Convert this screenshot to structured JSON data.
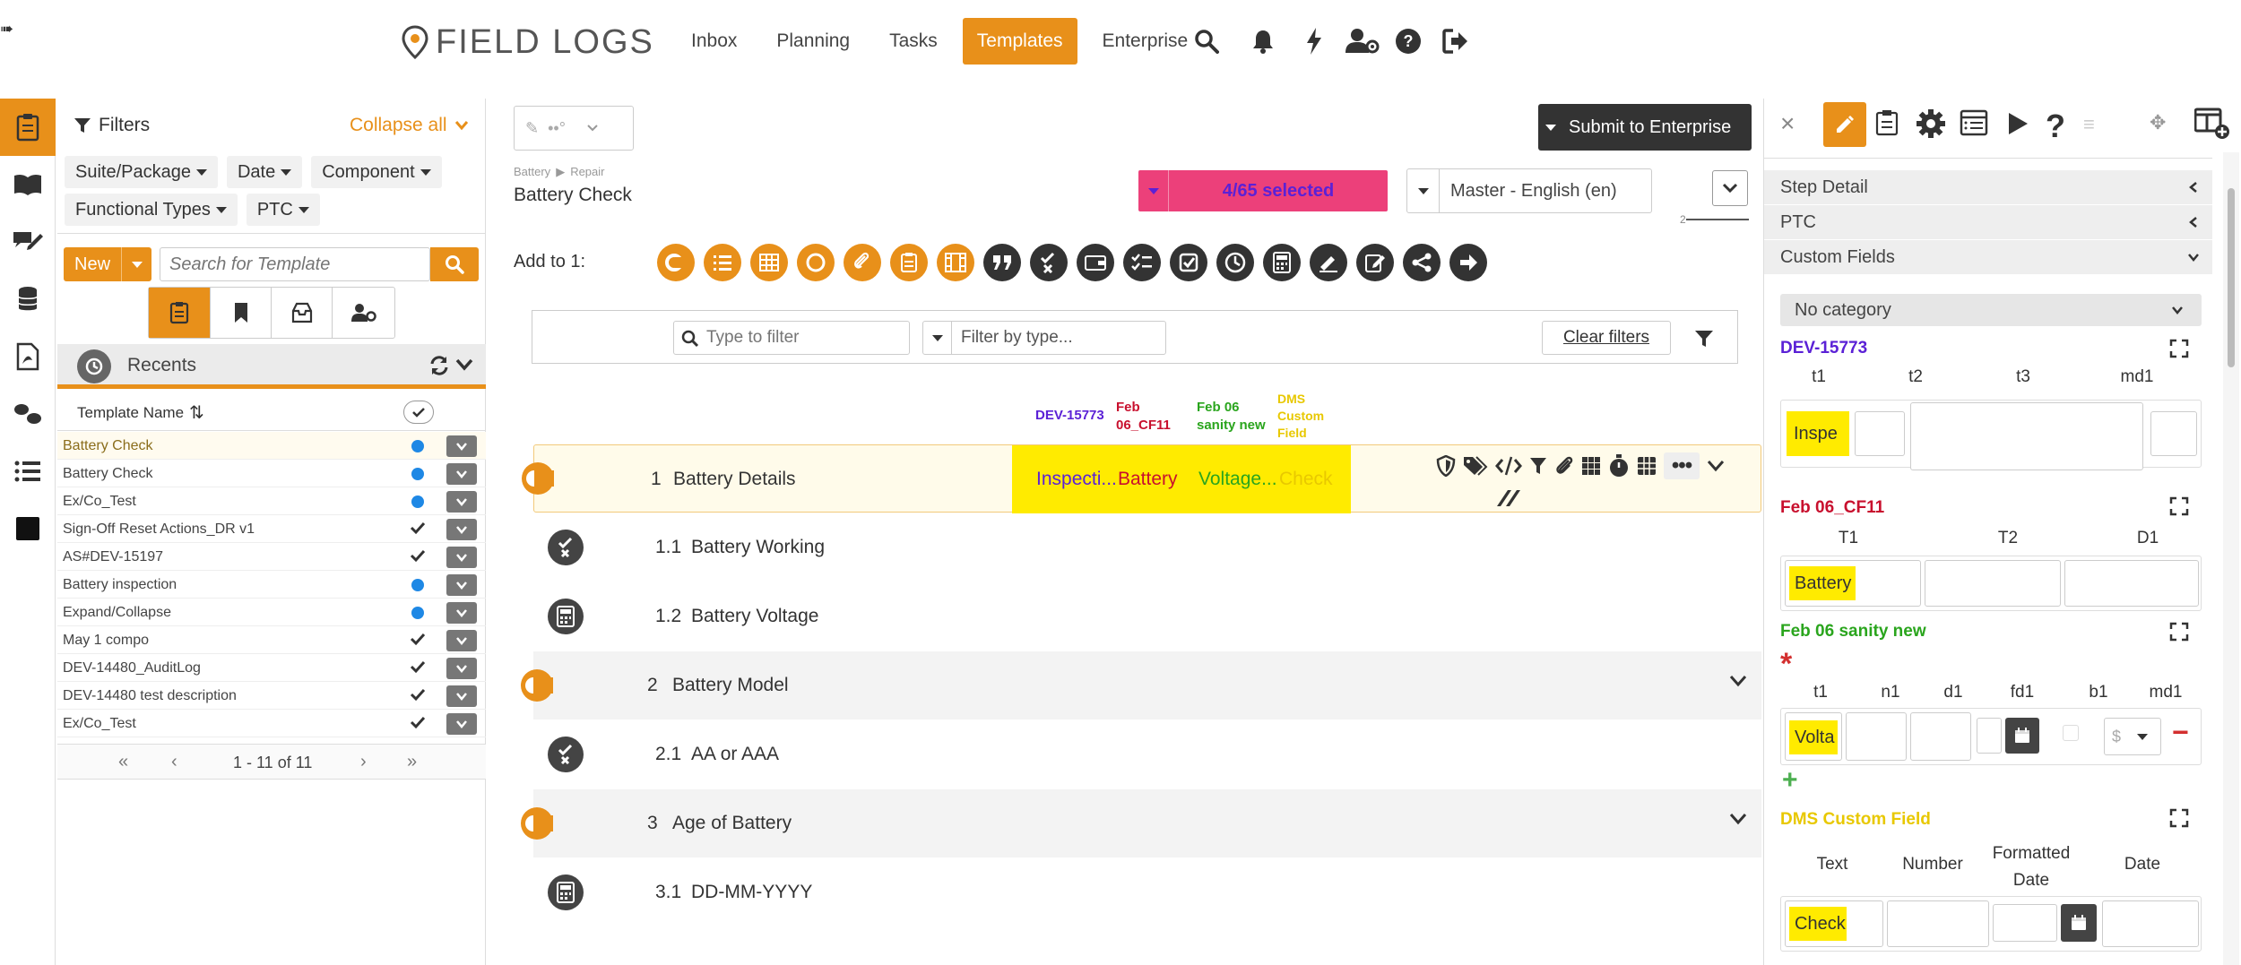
{
  "app": {
    "brand": "FIELD LOGS",
    "nav": [
      "Inbox",
      "Planning",
      "Tasks",
      "Templates",
      "Enterprise"
    ],
    "active_nav": "Templates",
    "accent": "#e8901a"
  },
  "filters": {
    "title": "Filters",
    "collapse_all": "Collapse all",
    "chips": [
      "Suite/Package",
      "Date",
      "Component",
      "Functional Types",
      "PTC"
    ],
    "new_label": "New",
    "search_placeholder": "Search for Template",
    "recents_label": "Recents",
    "column_header": "Template Name",
    "rows": [
      {
        "name": "Battery Check",
        "status": "dot"
      },
      {
        "name": "Battery Check",
        "status": "dot"
      },
      {
        "name": "Ex/Co_Test",
        "status": "dot"
      },
      {
        "name": "Sign-Off Reset Actions_DR v1",
        "status": "check"
      },
      {
        "name": "AS#DEV-15197",
        "status": "check"
      },
      {
        "name": "Battery inspection",
        "status": "dot"
      },
      {
        "name": "Expand/Collapse",
        "status": "dot"
      },
      {
        "name": "May 1 compo",
        "status": "check"
      },
      {
        "name": "DEV-14480_AuditLog",
        "status": "check"
      },
      {
        "name": "DEV-14480 test description",
        "status": "check"
      },
      {
        "name": "Ex/Co_Test",
        "status": "check"
      }
    ],
    "pagination": "1 - 11 of 11"
  },
  "center": {
    "pencil_label": "••°",
    "submit_label": "Submit to Enterprise",
    "breadcrumb": [
      "Battery",
      "Repair"
    ],
    "template_title": "Battery Check",
    "selected_label": "4/65 selected",
    "language": "Master - English (en)",
    "indicator": "2",
    "add_to_label": "Add to 1:",
    "filter_placeholder": "Type to filter",
    "type_placeholder": "Filter by type...",
    "clear_filters": "Clear filters",
    "col_tags": [
      {
        "text": "DEV-15773",
        "color": "#5b21d6"
      },
      {
        "text": "Feb 06_CF11",
        "color": "#c8102e"
      },
      {
        "text": "Feb 06 sanity new",
        "color": "#2aa51d"
      },
      {
        "text": "DMS Custom Field",
        "color": "#e8c800"
      }
    ],
    "step1": {
      "num": "1",
      "label": "Battery Details",
      "values": [
        "Inspecti...",
        "Battery",
        "Voltage...",
        "Check"
      ]
    },
    "steps": [
      {
        "num": "1.1",
        "label": "Battery Working",
        "icon": "close-circle-icon",
        "kind": "sub"
      },
      {
        "num": "1.2",
        "label": "Battery Voltage",
        "icon": "calculator-icon",
        "kind": "sub"
      },
      {
        "num": "2",
        "label": "Battery Model",
        "icon": "c-icon",
        "kind": "group"
      },
      {
        "num": "2.1",
        "label": "AA or AAA",
        "icon": "close-circle-icon",
        "kind": "sub"
      },
      {
        "num": "3",
        "label": "Age of Battery",
        "icon": "c-icon",
        "kind": "group"
      },
      {
        "num": "3.1",
        "label": "DD-MM-YYYY",
        "icon": "calculator-icon",
        "kind": "sub"
      }
    ]
  },
  "right": {
    "accordions": [
      "Step Detail",
      "PTC",
      "Custom Fields"
    ],
    "category": "No category",
    "sections": {
      "dev": {
        "title": "DEV-15773",
        "color": "#5b21d6",
        "cols": [
          "t1",
          "t2",
          "t3",
          "md1"
        ],
        "value": "Inspe"
      },
      "feb": {
        "title": "Feb 06_CF11",
        "color": "#c8102e",
        "cols": [
          "T1",
          "T2",
          "D1"
        ],
        "value": "Battery"
      },
      "sanity": {
        "title": "Feb 06 sanity new",
        "color": "#2aa51d",
        "cols": [
          "t1",
          "n1",
          "d1",
          "fd1",
          "b1",
          "md1"
        ],
        "value": "Volta",
        "select": "$"
      },
      "dms": {
        "title": "DMS Custom Field",
        "color": "#e8c800",
        "cols": [
          "Text",
          "Number",
          "Formatted Date",
          "Date"
        ],
        "value": "Check"
      }
    }
  }
}
